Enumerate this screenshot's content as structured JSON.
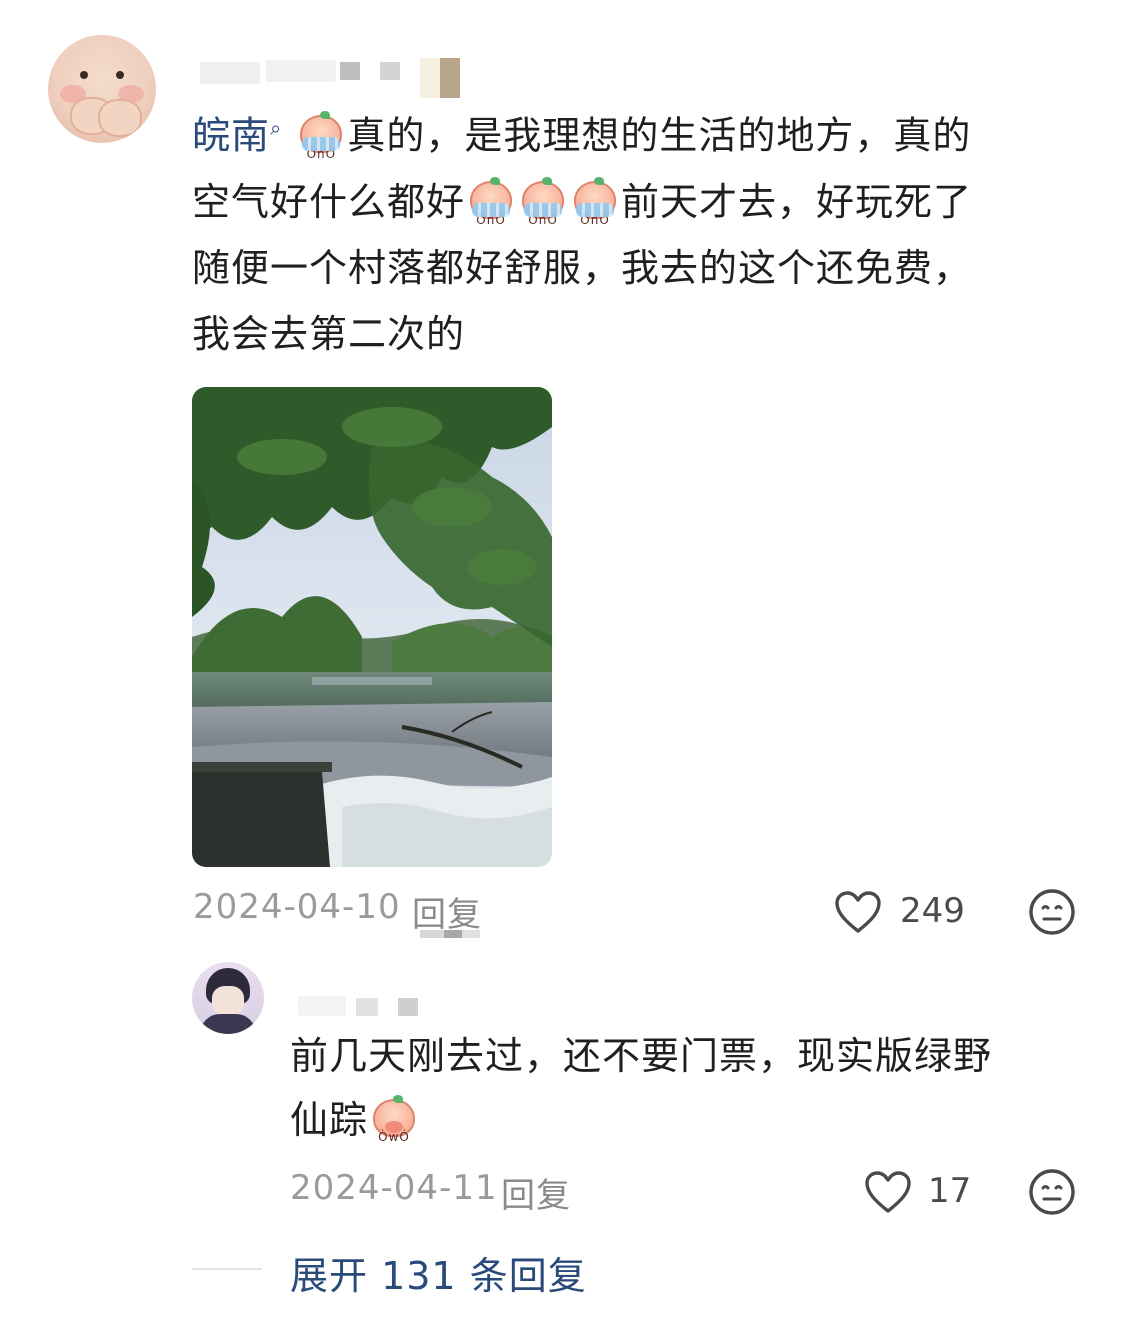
{
  "comment": {
    "location": "皖南",
    "text_line1_after_emoji": "真的，是我理想的生活的地方，真的",
    "text_line2_before_emoji": "空气好什么都好",
    "text_line2_after_emoji": "前天才去，好玩死了",
    "text_line3": "随便一个村落都好舒服，我去的这个还免费，",
    "text_line4": "我会去第二次的",
    "date": "2024-04-10",
    "reply_label": "回复",
    "like_count": "249",
    "photo_icon_name": "river-weir-photo"
  },
  "reply": {
    "text_line1": "前几天刚去过，还不要门票，现实版绿野",
    "text_line2": "仙踪",
    "date": "2024-04-11",
    "reply_label": "回复",
    "like_count": "17"
  },
  "expand_label": "展开 131 条回复",
  "icons": {
    "like": "heart-outline-icon",
    "dislike": "neutral-face-icon",
    "location": "search-location-icon"
  },
  "colors": {
    "link_blue": "#2a4a7a",
    "meta_gray": "#9a9a9a"
  }
}
